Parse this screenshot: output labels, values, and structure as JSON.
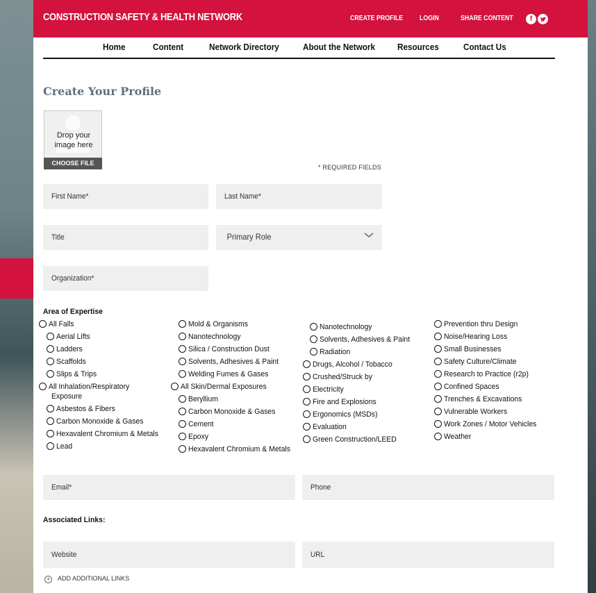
{
  "header": {
    "brand": "CONSTRUCTION SAFETY & HEALTH NETWORK",
    "links": [
      "CREATE PROFILE",
      "LOGIN",
      "SHARE CONTENT"
    ],
    "social": [
      "facebook-icon",
      "twitter-icon"
    ],
    "accent_color": "#d3123d"
  },
  "nav": {
    "items": [
      "Home",
      "Content",
      "Network Directory",
      "About the Network",
      "Resources",
      "Contact Us"
    ]
  },
  "page": {
    "title": "Create Your Profile",
    "dropzone_text_1": "Drop your",
    "dropzone_text_2": "image here",
    "choose_file": "CHOOSE FILE",
    "required_note": "* REQUIRED FIELDS"
  },
  "form": {
    "first_name": "First Name*",
    "last_name": "Last Name*",
    "title": "Title",
    "primary_role": "Primary Role",
    "organization": "Organization*",
    "expertise_label": "Area of Expertise",
    "email": "Email*",
    "phone": "Phone",
    "links_label": "Associated Links:",
    "website": "Website",
    "url": "URL",
    "add_links": "ADD ADDITIONAL LINKS"
  },
  "expertise": {
    "col1": [
      "All Falls",
      "Aerial Lifts",
      "Ladders",
      "Scaffolds",
      "Slips & Trips",
      "All Inhalation/Respiratory",
      "Exposure",
      "Asbestos & Fibers",
      "Carbon Monoxide & Gases",
      "Hexavalent Chromium & Metals",
      "Lead"
    ],
    "col2": [
      "Mold & Organisms",
      "Nanotechnology",
      "Silica / Construction Dust",
      "Solvents, Adhesives & Paint",
      "Welding Fumes & Gases",
      "All Skin/Dermal Exposures",
      "Beryllium",
      "Carbon Monoxide & Gases",
      "Cement",
      "Epoxy",
      "Hexavalent Chromium & Metals"
    ],
    "col3": [
      "Nanotechnology",
      "Solvents, Adhesives & Paint",
      "Radiation",
      "Drugs, Alcohol / Tobacco",
      "Crushed/Struck by",
      "Electricity",
      "Fire and Explosions",
      "Ergonomics (MSDs)",
      "Evaluation",
      "Green Construction/LEED"
    ],
    "col4": [
      "Prevention thru Design",
      "Noise/Hearing Loss",
      "Small Businesses",
      "Safety Culture/Climate",
      "Research to Practice (r2p)",
      "Confined Spaces",
      "Trenches & Excavations",
      "Vulnerable Workers",
      "Work Zones / Motor Vehicles",
      "Weather"
    ]
  }
}
